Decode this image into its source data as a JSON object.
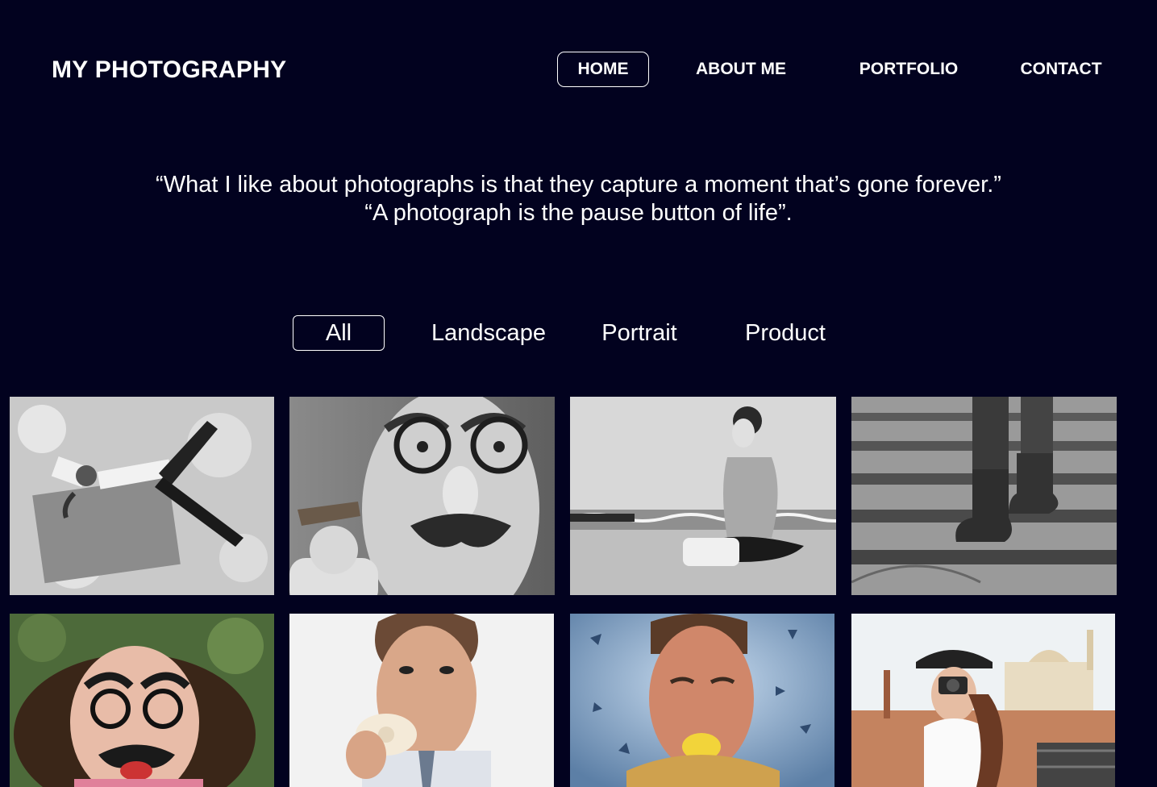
{
  "brand": {
    "title": "MY PHOTOGRAPHY"
  },
  "nav": {
    "items": [
      {
        "label": "HOME",
        "active": true
      },
      {
        "label": "ABOUT ME",
        "active": false
      },
      {
        "label": "PORTFOLIO",
        "active": false
      },
      {
        "label": "CONTACT",
        "active": false
      }
    ]
  },
  "quote": {
    "line1": "“What I like about photographs is that they capture a moment that’s gone forever.”",
    "line2": "“A photograph is the pause button of life”."
  },
  "filters": {
    "items": [
      {
        "label": "All",
        "active": true
      },
      {
        "label": "Landscape",
        "active": false
      },
      {
        "label": "Portrait",
        "active": false
      },
      {
        "label": "Product",
        "active": false
      }
    ]
  },
  "colors": {
    "background": "#02021f",
    "text": "#ffffff"
  }
}
